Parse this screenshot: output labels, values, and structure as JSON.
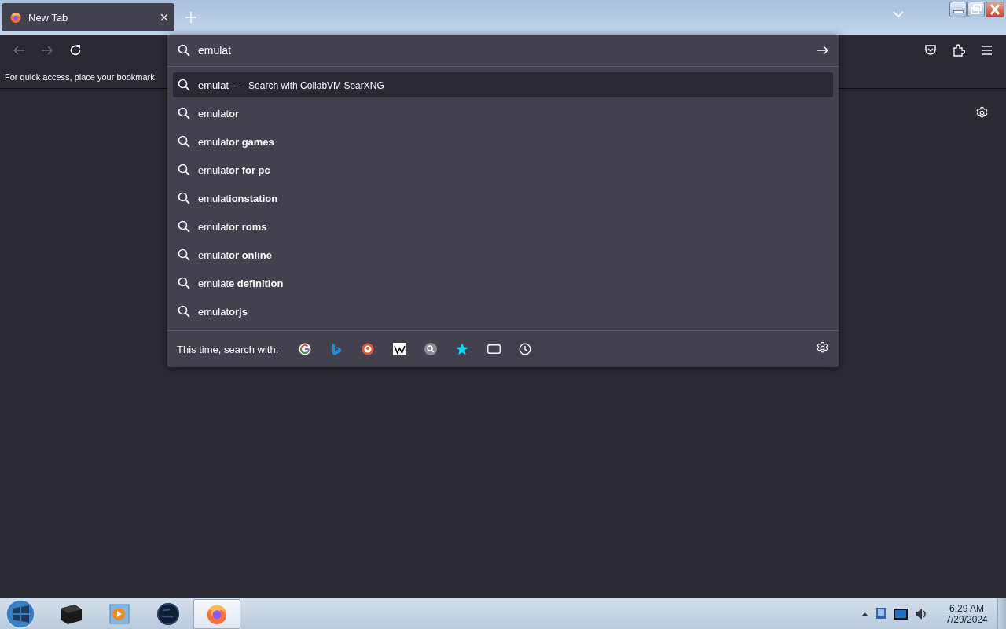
{
  "tab": {
    "title": "New Tab",
    "selected": true
  },
  "toolbar": {
    "nav_buttons": [
      {
        "kind": "back",
        "disabled": true
      },
      {
        "kind": "forward",
        "disabled": true
      },
      {
        "kind": "reload",
        "disabled": false
      }
    ]
  },
  "bookmarks_bar": {
    "message": "For quick access, place your bookmark"
  },
  "urlbar": {
    "value": "emulat",
    "heuristic": {
      "query": "emulat",
      "separator": "—",
      "action": "Search with CollabVM SearXNG",
      "selected": true
    },
    "suggestions": [
      {
        "text": "emulat**or**",
        "selected": false
      },
      {
        "text": "emulat**or games**",
        "selected": false
      },
      {
        "text": "emulat**or for pc**",
        "selected": false
      },
      {
        "text": "emulat**ionstation**",
        "selected": false
      },
      {
        "text": "emulat**or roms**",
        "selected": false
      },
      {
        "text": "emulat**or online**",
        "selected": false
      },
      {
        "text": "emulat**e definition**",
        "selected": false
      },
      {
        "text": "emulat**orjs**",
        "selected": false
      }
    ],
    "search_with": {
      "label": "This time, search with:",
      "engines": [
        {
          "kind": "google"
        },
        {
          "kind": "bing"
        },
        {
          "kind": "duckduckgo"
        },
        {
          "kind": "wikipedia"
        },
        {
          "kind": "searx"
        },
        {
          "kind": "bookmarks"
        },
        {
          "kind": "tabs"
        },
        {
          "kind": "history"
        }
      ]
    }
  },
  "taskbar": {
    "apps": [
      {
        "kind": "explorer",
        "selected": false
      },
      {
        "kind": "media",
        "selected": false
      },
      {
        "kind": "globe",
        "selected": false
      },
      {
        "kind": "firefox",
        "selected": true
      }
    ],
    "clock": {
      "time": "6:29 AM",
      "date": "7/29/2024"
    }
  }
}
